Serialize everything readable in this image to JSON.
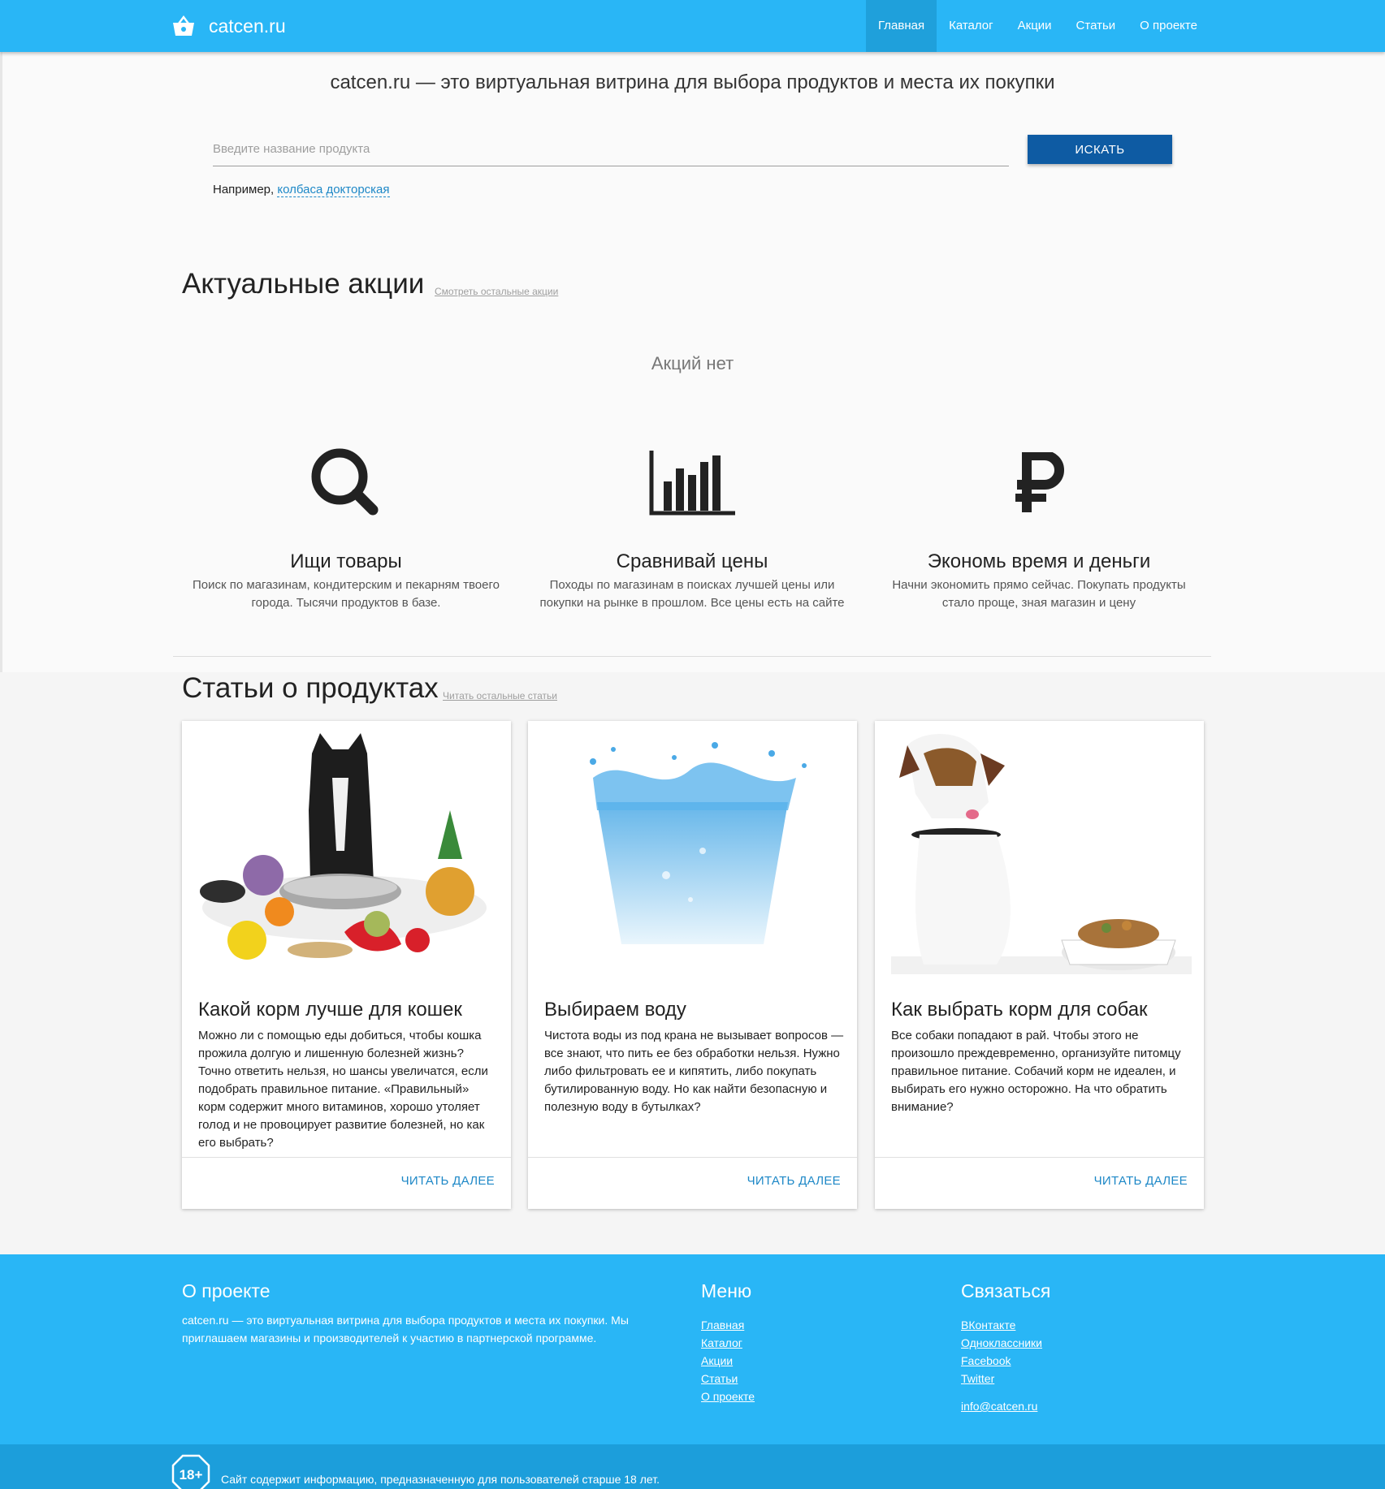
{
  "header": {
    "brand": "catcen.ru",
    "nav": [
      "Главная",
      "Каталог",
      "Акции",
      "Статьи",
      "О проекте"
    ],
    "active_index": 0
  },
  "hero": {
    "tagline": "catcen.ru — это виртуальная витрина для выбора продуктов и места их покупки",
    "search_placeholder": "Введите название продукта",
    "search_button": "ИСКАТЬ",
    "example_prefix": "Например,",
    "example_link": "колбаса докторская"
  },
  "promos": {
    "title": "Актуальные акции",
    "link": "Смотреть остальные акции",
    "empty_text": "Акций нет"
  },
  "features": [
    {
      "icon": "search-icon",
      "title": "Ищи товары",
      "text": "Поиск по магазинам, кондитерским и пекарням твоего города. Тысячи продуктов в базе."
    },
    {
      "icon": "bar-chart-icon",
      "title": "Сравнивай цены",
      "text": "Походы по магазинам в поисках лучшей цены или покупки на рынке в прошлом. Все цены есть на сайте"
    },
    {
      "icon": "ruble-icon",
      "title": "Экономь время и деньги",
      "text": "Начни экономить прямо сейчас. Покупать продукты стало проще, зная магазин и цену"
    }
  ],
  "articles": {
    "title": "Статьи о продуктах",
    "link": "Читать остальные статьи",
    "items": [
      {
        "image": "cat-with-vegetables",
        "title": "Какой корм лучше для кошек",
        "text": "Можно ли с помощью еды добиться, чтобы кошка прожила долгую и лишенную болезней жизнь? Точно ответить нельзя, но шансы увеличатся, если подобрать правильное питание. «Правильный» корм содержит много витаминов, хорошо утоляет голод и не провоцирует развитие болезней, но как его выбрать?",
        "action": "ЧИТАТЬ ДАЛЕЕ"
      },
      {
        "image": "glass-of-water",
        "title": "Выбираем воду",
        "text": "Чистота воды из под крана не вызывает вопросов — все знают, что пить ее без обработки нельзя. Нужно либо фильтровать ее и кипятить, либо покупать бутилированную воду. Но как найти безопасную и полезную воду в бутылках?",
        "action": "ЧИТАТЬ ДАЛЕЕ"
      },
      {
        "image": "dog-with-food-bowl",
        "title": "Как выбрать корм для собак",
        "text": "Все собаки попадают в рай. Чтобы этого не произошло преждевременно, организуйте питомцу правильное питание. Собачий корм не идеален, и выбирать его нужно осторожно. На что обратить внимание?",
        "action": "ЧИТАТЬ ДАЛЕЕ"
      }
    ]
  },
  "footer": {
    "about_title": "О проекте",
    "about_text": "catcen.ru — это виртуальная витрина для выбора продуктов и места их покупки. Мы приглашаем магазины и производителей к участию в партнерской программе.",
    "menu_title": "Меню",
    "menu": [
      "Главная",
      "Каталог",
      "Акции",
      "Статьи",
      "О проекте"
    ],
    "contact_title": "Связаться",
    "contacts": [
      "ВКонтакте",
      "Одноклассники",
      "Facebook",
      "Twitter"
    ],
    "email": "info@catcen.ru",
    "age_badge": "18+",
    "age_notice": "Сайт содержит информацию, предназначенную для пользователей старше 18 лет."
  },
  "colors": {
    "primary": "#29b6f6",
    "button": "#0e5ba3",
    "link": "#1e88c7"
  }
}
